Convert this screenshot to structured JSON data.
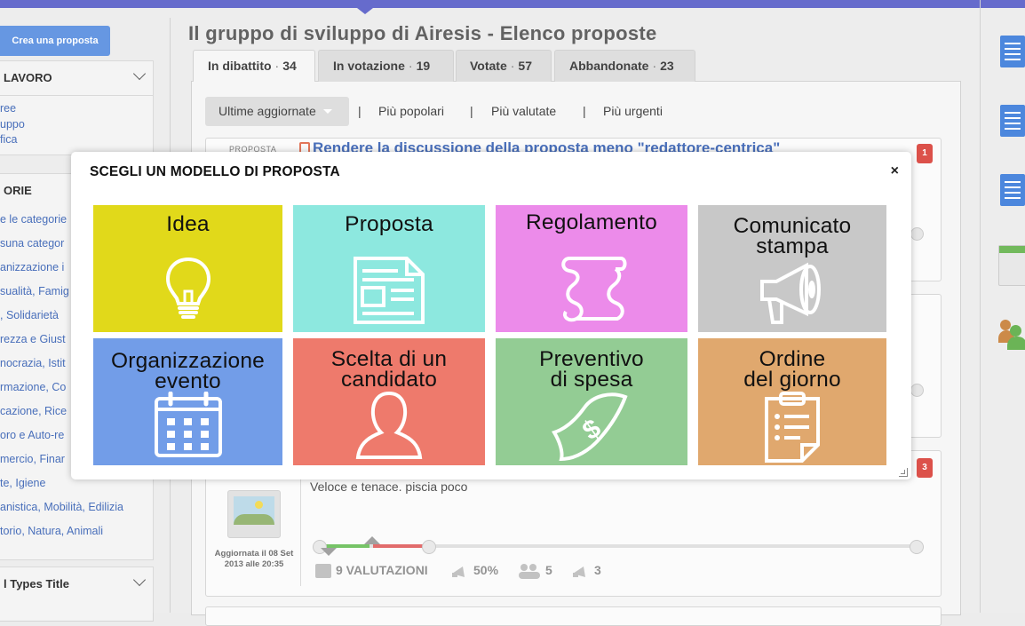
{
  "header": {
    "title": "Il gruppo di sviluppo di Airesis - Elenco proposte"
  },
  "sidebar": {
    "create_button": "Crea una proposta",
    "lavoro": {
      "title": "LAVORO",
      "items": [
        "ree",
        "uppo",
        "fica"
      ]
    },
    "categorie": {
      "title": "ORIE",
      "items": [
        "e le categorie",
        "suna categor",
        "anizzazione i",
        "sualità, Famig",
        ", Solidarietà",
        "rezza e Giust",
        "nocrazia, Istit",
        "rmazione, Co",
        "cazione, Rice",
        "oro e Auto-re",
        "mercio, Finar",
        "te, Igiene",
        "anistica, Mobilità, Edilizia",
        "torio, Natura, Animali"
      ]
    },
    "types": {
      "title": "l Types Title"
    }
  },
  "tabs": [
    {
      "label": "In dibattito",
      "count": "34",
      "active": true
    },
    {
      "label": "In votazione",
      "count": "19",
      "active": false
    },
    {
      "label": "Votate",
      "count": "57",
      "active": false
    },
    {
      "label": "Abbandonate",
      "count": "23",
      "active": false
    }
  ],
  "sort": {
    "active": "Ultime aggiornate",
    "options": [
      "Più popolari",
      "Più valutate",
      "Più urgenti"
    ],
    "separator": "|",
    "tab_separator": "·"
  },
  "cards": [
    {
      "label": "PROPOSTA",
      "title": "Rendere la discussione della proposta meno \"redattore-centrica\"",
      "badge": "1"
    },
    {
      "badge": "3",
      "description": "Veloce e tenace. piscia poco",
      "updated": "Aggiornata il 08 Set 2013 alle 20:35",
      "ratings_label": "9 VALUTAZIONI",
      "percent": "50%",
      "participants": "5",
      "votes": "3"
    }
  ],
  "modal": {
    "title": "SCEGLI UN MODELLO DI PROPOSTA",
    "close": "×",
    "tiles": [
      {
        "line1": "Idea",
        "line2": "",
        "icon": "lightbulb-icon",
        "color": "#e1d91a"
      },
      {
        "line1": "Proposta",
        "line2": "",
        "icon": "document-icon",
        "color": "#8de8df"
      },
      {
        "line1": "Regolamento",
        "line2": "",
        "icon": "scroll-icon",
        "color": "#ec8bea"
      },
      {
        "line1": "Comunicato",
        "line2": "stampa",
        "icon": "megaphone-icon",
        "color": "#c8c8c8"
      },
      {
        "line1": "Organizzazione",
        "line2": "evento",
        "icon": "calendar-icon",
        "color": "#729de8"
      },
      {
        "line1": "Scelta di un",
        "line2": "candidato",
        "icon": "person-icon",
        "color": "#ee7a6c"
      },
      {
        "line1": "Preventivo",
        "line2": "di spesa",
        "icon": "money-icon",
        "color": "#93cc94"
      },
      {
        "line1": "Ordine",
        "line2": "del giorno",
        "icon": "clipboard-icon",
        "color": "#e0a86e"
      }
    ]
  }
}
